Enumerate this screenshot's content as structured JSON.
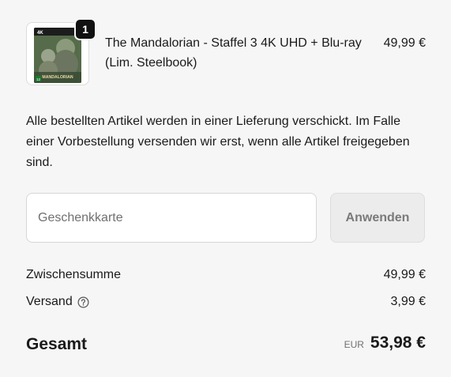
{
  "order_item": {
    "quantity": "1",
    "title": "The Mandalorian - Staffel 3 4K UHD + Blu-ray (Lim. Steelbook)",
    "price": "49,99 €",
    "cover": {
      "top_text": "4K",
      "logo_text": "MANDALORIAN",
      "age_rating": "12",
      "brand_color": "#1a7a2c"
    }
  },
  "shipping_notice": "Alle bestellten Artikel werden in einer Lieferung verschickt. Im Falle einer Vorbestellung versenden wir erst, wenn alle Artikel freigegeben sind.",
  "gift_card": {
    "placeholder": "Geschenkkarte",
    "apply_label": "Anwenden"
  },
  "summary": {
    "subtotal_label": "Zwischensumme",
    "subtotal_value": "49,99 €",
    "shipping_label": "Versand",
    "shipping_help_icon": "question-circle-icon",
    "shipping_value": "3,99 €",
    "total_label": "Gesamt",
    "currency": "EUR",
    "total_value": "53,98 €"
  }
}
